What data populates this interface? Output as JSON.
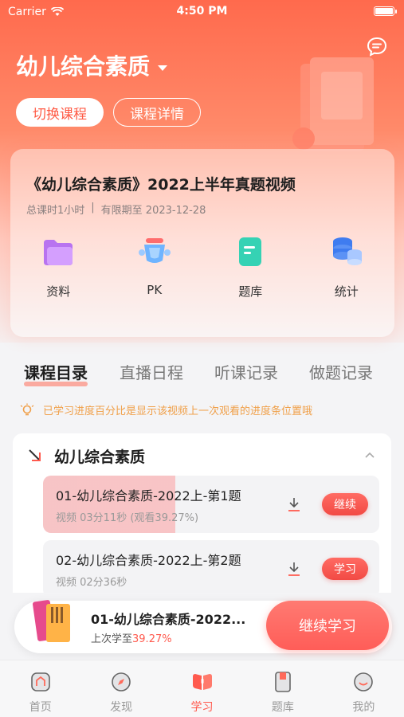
{
  "status_bar": {
    "carrier": "Carrier",
    "time": "4:50 PM"
  },
  "header": {
    "course_title": "幼儿综合素质",
    "switch_course": "切换课程",
    "course_detail": "课程详情"
  },
  "course_card": {
    "title": "《幼儿综合素质》2022上半年真题视频",
    "total_hours": "总课时1小时",
    "valid_until": "有限期至 2023-12-28",
    "features": [
      {
        "label": "资料",
        "icon": "folder-icon"
      },
      {
        "label": "PK",
        "icon": "pk-icon"
      },
      {
        "label": "题库",
        "icon": "question-bank-icon"
      },
      {
        "label": "统计",
        "icon": "stats-icon"
      }
    ]
  },
  "tabs": [
    "课程目录",
    "直播日程",
    "听课记录",
    "做题记录"
  ],
  "notice": "已学习进度百分比是显示该视频上一次观看的进度条位置哦",
  "catalog": {
    "section_title": "幼儿综合素质",
    "lessons": [
      {
        "name": "01-幼儿综合素质-2022上-第1题",
        "meta": "视频 03分11秒 (观看39.27%)",
        "action": "继续",
        "progress": 0.3927
      },
      {
        "name": "02-幼儿综合素质-2022上-第2题",
        "meta": "视频 02分36秒",
        "action": "学习",
        "progress": 0
      }
    ]
  },
  "resume": {
    "title": "01-幼儿综合素质-2022...",
    "last_prefix": "上次学至",
    "last_percent": "39.27%",
    "button": "继续学习"
  },
  "tabbar": [
    {
      "label": "首页",
      "icon": "home-icon"
    },
    {
      "label": "发现",
      "icon": "compass-icon"
    },
    {
      "label": "学习",
      "icon": "study-book-icon",
      "active": true
    },
    {
      "label": "题库",
      "icon": "question-bank-icon"
    },
    {
      "label": "我的",
      "icon": "profile-icon"
    }
  ],
  "colors": {
    "accent": "#ff5a4e",
    "hero_top": "#ff6a4d",
    "notice": "#f0a04a"
  }
}
